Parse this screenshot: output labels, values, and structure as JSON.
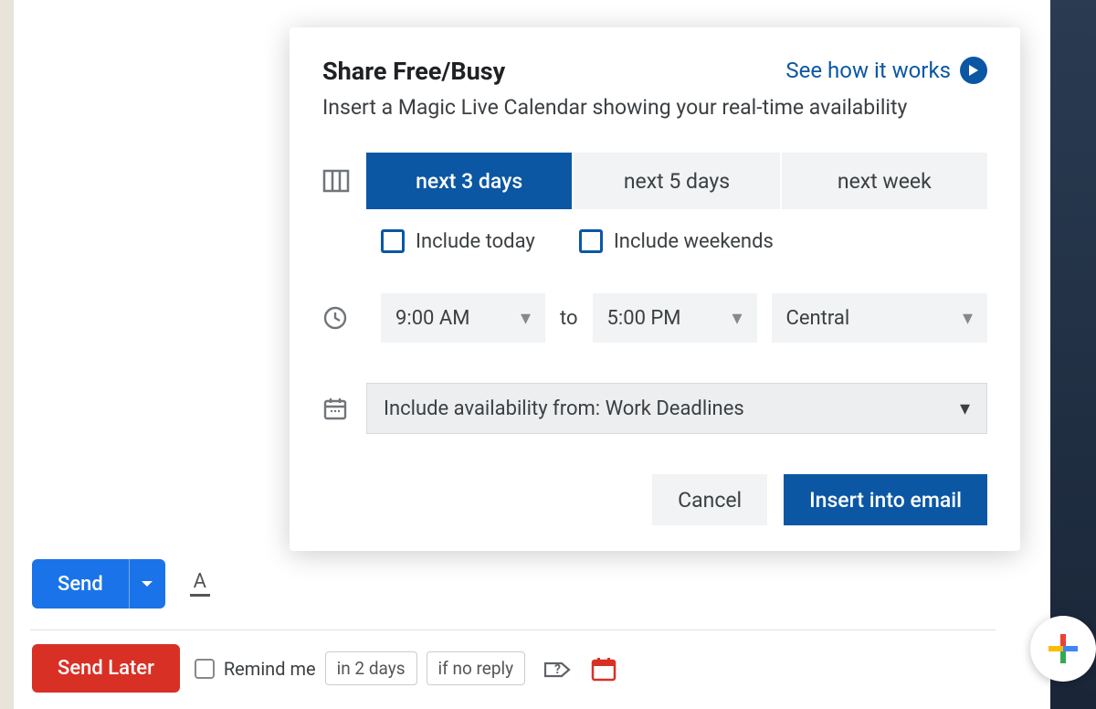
{
  "compose": {
    "send": "Send",
    "send_later": "Send Later",
    "remind_label": "Remind me",
    "remind_chip_time": "in 2 days",
    "remind_chip_cond": "if no reply"
  },
  "dialog": {
    "title": "Share Free/Busy",
    "help_link": "See how it works",
    "subtitle": "Insert a Magic Live Calendar showing your real-time availability",
    "range_options": [
      "next 3 days",
      "next 5 days",
      "next week"
    ],
    "range_selected_index": 0,
    "include_today": "Include today",
    "include_weekends": "Include weekends",
    "time_from": "9:00 AM",
    "time_to_label": "to",
    "time_to": "5:00 PM",
    "timezone": "Central",
    "availability_source": "Include availability from: Work Deadlines",
    "cancel": "Cancel",
    "insert": "Insert into email"
  }
}
